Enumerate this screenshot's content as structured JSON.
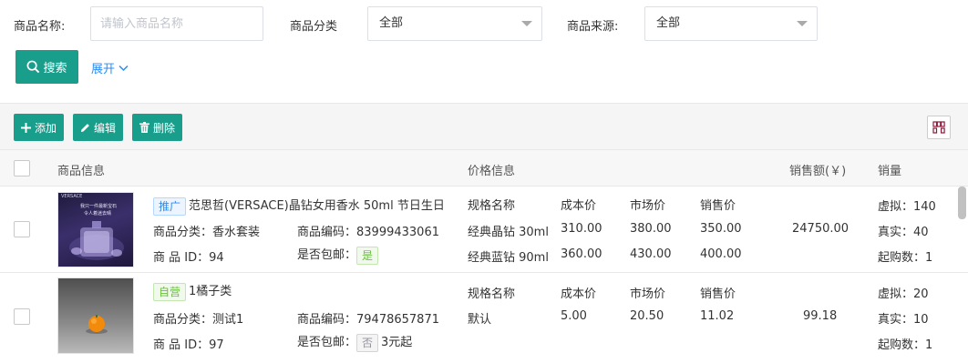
{
  "filters": {
    "name_label": "商品名称:",
    "name_placeholder": "请输入商品名称",
    "category_label": "商品分类",
    "category_value": "全部",
    "source_label": "商品来源:",
    "source_value": "全部"
  },
  "actions": {
    "search_label": "搜索",
    "expand_label": "展开"
  },
  "toolbar": {
    "add_label": "添加",
    "edit_label": "编辑",
    "delete_label": "删除"
  },
  "table": {
    "headers": {
      "product_info": "商品信息",
      "price_info": "价格信息",
      "sales_amount": "销售额(￥)",
      "sales_volume": "销量"
    },
    "price_headers": [
      "规格名称",
      "成本价",
      "市场价",
      "销售价"
    ],
    "rows": [
      {
        "tag": "推广",
        "title": "范思哲(VERSACE)晶钻女用香水 50ml 节日生日",
        "category": "商品分类：香水套装",
        "code": "商品编码：83999433061",
        "id_line": "商 品 ID：94",
        "shipping_label": "是否包邮：",
        "shipping_value": "是",
        "shipping_extra": "",
        "prices": [
          [
            "经典晶钻 30ml",
            "310.00",
            "380.00",
            "350.00"
          ],
          [
            "经典蓝钻 90ml",
            "360.00",
            "430.00",
            "400.00"
          ]
        ],
        "sales_amount": "24750.00",
        "virtual": "虚拟：140",
        "real": "真实：40",
        "min_buy": "起购数：1",
        "thumb_brand": "VERSACE",
        "thumb_text1": "我只一件最新宝石",
        "thumb_text2": "令人着迷去晴"
      },
      {
        "tag": "自营",
        "title": "1橘子类",
        "category": "商品分类：测试1",
        "code": "商品编码：79478657871",
        "id_line": "商 品 ID：97",
        "shipping_label": "是否包邮：",
        "shipping_value": "否",
        "shipping_extra": "3元起",
        "prices": [
          [
            "默认",
            "5.00",
            "20.50",
            "11.02"
          ]
        ],
        "sales_amount": "99.18",
        "virtual": "虚拟：20",
        "real": "真实：10",
        "min_buy": "起购数：1"
      }
    ]
  },
  "colors": {
    "primary": "#1a9e8c",
    "link": "#2d8cf0"
  }
}
